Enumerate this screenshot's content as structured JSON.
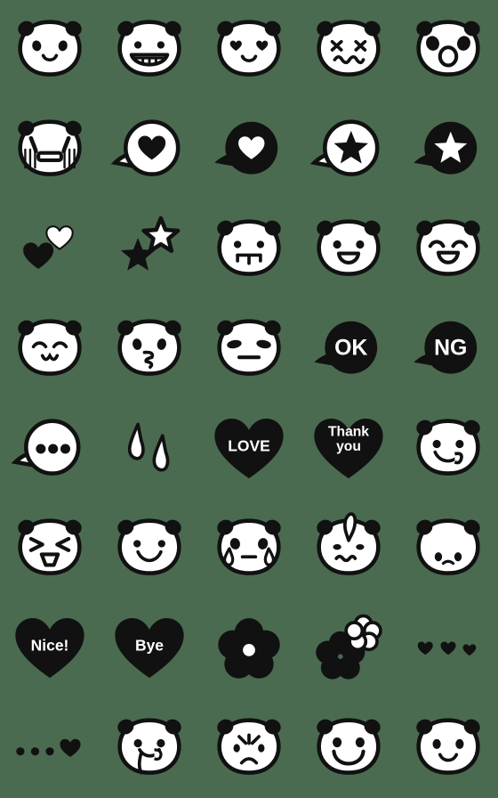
{
  "sheet": {
    "title": "Panda Emoji Sticker Sheet",
    "background_color": "#4b6b50",
    "ink_color": "#111111",
    "paper_color": "#ffffff",
    "columns": 5,
    "rows": 8,
    "cell_size_px": 112
  },
  "stickers": [
    {
      "id": "r1c1",
      "row": 1,
      "col": 1,
      "kind": "panda-face",
      "name": "panda-smiling-face",
      "label": "smiling panda",
      "text": ""
    },
    {
      "id": "r1c2",
      "row": 1,
      "col": 2,
      "kind": "panda-face",
      "name": "panda-grinning-teeth-face",
      "label": "grinning panda with teeth",
      "text": ""
    },
    {
      "id": "r1c3",
      "row": 1,
      "col": 3,
      "kind": "panda-face",
      "name": "panda-heart-eyes-face",
      "label": "panda with heart eyes",
      "text": ""
    },
    {
      "id": "r1c4",
      "row": 1,
      "col": 4,
      "kind": "panda-face",
      "name": "panda-dizzy-x-eyes-face",
      "label": "dizzy panda with x eyes",
      "text": ""
    },
    {
      "id": "r1c5",
      "row": 1,
      "col": 5,
      "kind": "panda-face",
      "name": "panda-surprised-open-mouth-face",
      "label": "surprised panda, round open mouth",
      "text": ""
    },
    {
      "id": "r2c1",
      "row": 2,
      "col": 1,
      "kind": "panda-face",
      "name": "panda-bawling-crying-face",
      "label": "bawling panda streaming tears",
      "text": ""
    },
    {
      "id": "r2c2",
      "row": 2,
      "col": 2,
      "kind": "bubble",
      "name": "speech-bubble-black-heart",
      "label": "white speech bubble with black heart",
      "text": ""
    },
    {
      "id": "r2c3",
      "row": 2,
      "col": 3,
      "kind": "bubble",
      "name": "speech-bubble-white-heart-on-black",
      "label": "black speech bubble with white heart",
      "text": ""
    },
    {
      "id": "r2c4",
      "row": 2,
      "col": 4,
      "kind": "bubble",
      "name": "speech-bubble-black-star",
      "label": "white speech bubble with black star",
      "text": ""
    },
    {
      "id": "r2c5",
      "row": 2,
      "col": 5,
      "kind": "bubble",
      "name": "speech-bubble-white-star-on-black",
      "label": "black speech bubble with white star",
      "text": ""
    },
    {
      "id": "r3c1",
      "row": 3,
      "col": 1,
      "kind": "symbol",
      "name": "two-hearts-black-white",
      "label": "two hearts, black and white",
      "text": ""
    },
    {
      "id": "r3c2",
      "row": 3,
      "col": 2,
      "kind": "symbol",
      "name": "two-stars-black-white",
      "label": "two stars, black and white",
      "text": ""
    },
    {
      "id": "r3c3",
      "row": 3,
      "col": 3,
      "kind": "panda-face",
      "name": "panda-buck-teeth-face",
      "label": "panda with buck teeth",
      "text": ""
    },
    {
      "id": "r3c4",
      "row": 3,
      "col": 4,
      "kind": "panda-face",
      "name": "panda-happy-open-mouth-face",
      "label": "happy panda with open mouth",
      "text": ""
    },
    {
      "id": "r3c5",
      "row": 3,
      "col": 5,
      "kind": "panda-face",
      "name": "panda-laughing-closed-eyes-face",
      "label": "laughing panda with closed eyes",
      "text": ""
    },
    {
      "id": "r4c1",
      "row": 4,
      "col": 1,
      "kind": "panda-face",
      "name": "panda-sleepy-content-face",
      "label": "content panda with closed eyes",
      "text": ""
    },
    {
      "id": "r4c2",
      "row": 4,
      "col": 2,
      "kind": "panda-face",
      "name": "panda-kissing-face",
      "label": "kissing panda",
      "text": ""
    },
    {
      "id": "r4c3",
      "row": 4,
      "col": 3,
      "kind": "panda-face",
      "name": "panda-neutral-straight-mouth-face",
      "label": "neutral panda with straight mouth",
      "text": ""
    },
    {
      "id": "r4c4",
      "row": 4,
      "col": 4,
      "kind": "bubble-text",
      "name": "speech-bubble-ok",
      "label": "black speech bubble",
      "text": "OK"
    },
    {
      "id": "r4c5",
      "row": 4,
      "col": 5,
      "kind": "bubble-text",
      "name": "speech-bubble-ng",
      "label": "black speech bubble",
      "text": "NG"
    },
    {
      "id": "r5c1",
      "row": 5,
      "col": 1,
      "kind": "bubble",
      "name": "speech-bubble-ellipsis-dots",
      "label": "white speech bubble with three dots",
      "text": ""
    },
    {
      "id": "r5c2",
      "row": 5,
      "col": 2,
      "kind": "symbol",
      "name": "sweat-drops",
      "label": "two sweat drops",
      "text": ""
    },
    {
      "id": "r5c3",
      "row": 5,
      "col": 3,
      "kind": "heart-text",
      "name": "black-heart-love",
      "label": "black heart",
      "text": "LOVE"
    },
    {
      "id": "r5c4",
      "row": 5,
      "col": 4,
      "kind": "heart-text",
      "name": "black-heart-thank-you",
      "label": "black heart",
      "text": "Thank you",
      "line1": "Thank",
      "line2": "you"
    },
    {
      "id": "r5c5",
      "row": 5,
      "col": 5,
      "kind": "panda-face",
      "name": "panda-licking-lips-face",
      "label": "panda licking its lips",
      "text": ""
    },
    {
      "id": "r6c1",
      "row": 6,
      "col": 1,
      "kind": "panda-face",
      "name": "panda-frustrated-squinting-face",
      "label": "frustrated squinting panda",
      "text": ""
    },
    {
      "id": "r6c2",
      "row": 6,
      "col": 2,
      "kind": "panda-face",
      "name": "panda-smile-dot-eyes-face",
      "label": "smiling panda with dot eyes",
      "text": ""
    },
    {
      "id": "r6c3",
      "row": 6,
      "col": 3,
      "kind": "panda-face",
      "name": "panda-single-tear-face",
      "label": "panda with a single tear",
      "text": ""
    },
    {
      "id": "r6c4",
      "row": 6,
      "col": 4,
      "kind": "panda-face",
      "name": "panda-sweating-worried-face",
      "label": "worried panda with sweat drop",
      "text": ""
    },
    {
      "id": "r6c5",
      "row": 6,
      "col": 5,
      "kind": "panda-face",
      "name": "panda-sad-downcast-face",
      "label": "sad downcast panda",
      "text": ""
    },
    {
      "id": "r7c1",
      "row": 7,
      "col": 1,
      "kind": "heart-text",
      "name": "black-heart-nice",
      "label": "black heart",
      "text": "Nice!"
    },
    {
      "id": "r7c2",
      "row": 7,
      "col": 2,
      "kind": "heart-text",
      "name": "black-heart-bye",
      "label": "black heart",
      "text": "Bye"
    },
    {
      "id": "r7c3",
      "row": 7,
      "col": 3,
      "kind": "symbol",
      "name": "black-flower",
      "label": "black five petal flower",
      "text": ""
    },
    {
      "id": "r7c4",
      "row": 7,
      "col": 4,
      "kind": "symbol",
      "name": "two-flowers-black-white",
      "label": "two flowers, black and white",
      "text": ""
    },
    {
      "id": "r7c5",
      "row": 7,
      "col": 5,
      "kind": "symbol",
      "name": "three-small-black-hearts",
      "label": "three small black hearts",
      "text": ""
    },
    {
      "id": "r8c1",
      "row": 8,
      "col": 1,
      "kind": "symbol",
      "name": "three-dots-and-heart",
      "label": "three dots trailing into a heart",
      "text": ""
    },
    {
      "id": "r8c2",
      "row": 8,
      "col": 2,
      "kind": "panda-face",
      "name": "panda-drooling-face",
      "label": "drooling panda",
      "text": ""
    },
    {
      "id": "r8c3",
      "row": 8,
      "col": 3,
      "kind": "panda-face",
      "name": "panda-pleading-sad-face",
      "label": "pleading sad panda",
      "text": ""
    },
    {
      "id": "r8c4",
      "row": 8,
      "col": 4,
      "kind": "panda-face",
      "name": "panda-big-grin-face",
      "label": "panda with big grin",
      "text": ""
    },
    {
      "id": "r8c5",
      "row": 8,
      "col": 5,
      "kind": "panda-face",
      "name": "panda-gentle-smile-face",
      "label": "gently smiling panda",
      "text": ""
    }
  ]
}
